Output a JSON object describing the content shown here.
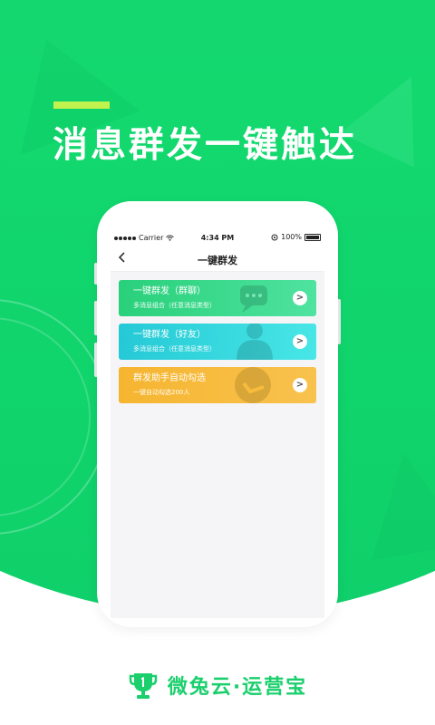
{
  "headline": "消息群发一键触达",
  "phone": {
    "status_bar": {
      "carrier": "Carrier",
      "time": "4:34 PM",
      "battery": "100%"
    },
    "nav": {
      "back_icon": "chevron-left-icon",
      "title": "一键群发"
    },
    "cards": [
      {
        "title": "一键群发（群聊）",
        "subtitle": "多消息组合（任意消息类型）",
        "color": "#29d07a",
        "arrow": ">"
      },
      {
        "title": "一键群发（好友）",
        "subtitle": "多消息组合（任意消息类型）",
        "color": "#25c9d6",
        "arrow": ">"
      },
      {
        "title": "群发助手自动勾选",
        "subtitle": "一键自动勾选200人",
        "color": "#f6b530",
        "arrow": ">"
      }
    ]
  },
  "brand": {
    "logo_icon": "trophy-icon",
    "name": "微兔云·运营宝",
    "color": "#1bcf6d"
  },
  "colors": {
    "primary_green": "#12d86e",
    "accent_lime": "#c2f24d"
  }
}
